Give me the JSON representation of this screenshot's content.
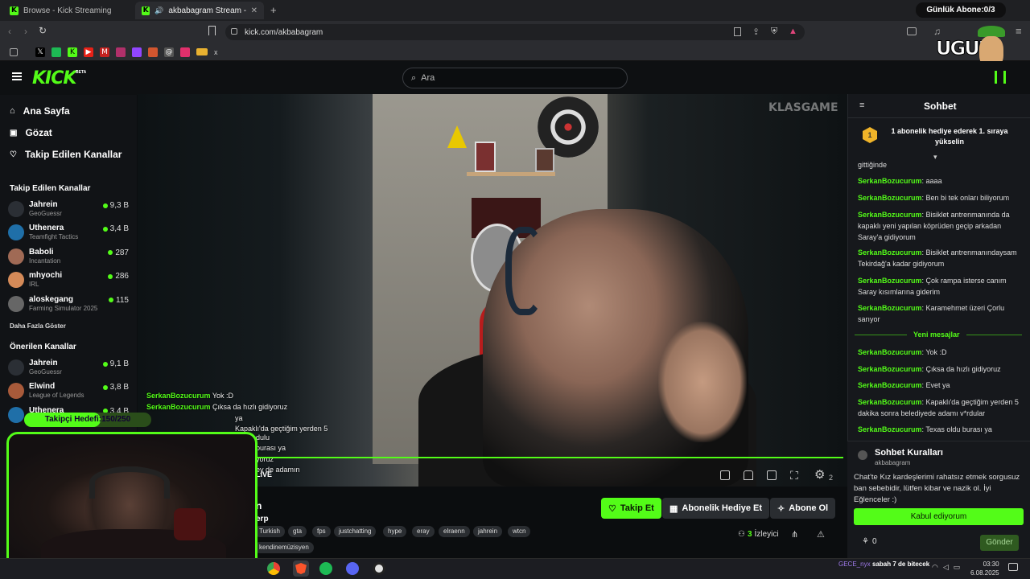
{
  "browser": {
    "tabs": [
      {
        "title": "Browse - Kick Streaming"
      },
      {
        "title": "akbabagram Stream - Watch L"
      }
    ],
    "url": "kick.com/akbabagram",
    "sub_counter": "Günlük Abone:0/3",
    "overlay_logo_text": "UGUR"
  },
  "header": {
    "logo": "KICK",
    "logo_badge": "BETA",
    "search_placeholder": "Ara"
  },
  "sidebar": {
    "nav": [
      {
        "label": "Ana Sayfa",
        "icon": "home-icon"
      },
      {
        "label": "Gözat",
        "icon": "browse-icon"
      },
      {
        "label": "Takip Edilen Kanallar",
        "icon": "heart-icon"
      }
    ],
    "followed_title": "Takip Edilen Kanallar",
    "followed": [
      {
        "name": "Jahrein",
        "game": "GeoGuessr",
        "viewers": "9,3 B",
        "color": "#2b2f35"
      },
      {
        "name": "Uthenera",
        "game": "Teamfight Tactics",
        "viewers": "3,4 B",
        "color": "#1f6fa8"
      },
      {
        "name": "Baboli",
        "game": "Incantation",
        "viewers": "287",
        "color": "#a06a55"
      },
      {
        "name": "mhyochi",
        "game": "IRL",
        "viewers": "286",
        "color": "#d48a58"
      },
      {
        "name": "aloskegang",
        "game": "Farming Simulator 2025",
        "viewers": "115",
        "color": "#666"
      }
    ],
    "show_more": "Daha Fazla Göster",
    "recommended_title": "Önerilen Kanallar",
    "recommended": [
      {
        "name": "Jahrein",
        "game": "GeoGuessr",
        "viewers": "9,1 B",
        "color": "#2b2f35"
      },
      {
        "name": "Elwind",
        "game": "League of Legends",
        "viewers": "3,8 B",
        "color": "#a85a3a"
      },
      {
        "name": "Uthenera",
        "game": "",
        "viewers": "3,4 B",
        "color": "#1f6fa8"
      }
    ]
  },
  "stream": {
    "overlay_watermark": "KLASGAME",
    "overlay_chat": [
      {
        "user": "SerkanBozucurum",
        "text": "Yok :D"
      },
      {
        "user": "SerkanBozucurum",
        "text": "Çıksa da hızlı gidiyoruz"
      },
      {
        "user": "",
        "text": "ya"
      },
      {
        "user": "",
        "text": "Kapaklı'da geçtiğim yerden 5"
      },
      {
        "user": "",
        "text": "dulu"
      },
      {
        "user": "",
        "text": "burası ya"
      },
      {
        "user": "",
        "text": "yoruz"
      },
      {
        "user": "",
        "text": "ey de adamın"
      }
    ],
    "goal_label": "Takipçi Hedefi:150/250",
    "goal_fraction": 0.6,
    "live_label": "LIVE",
    "player_count": "2",
    "title_partial": "n",
    "category_partial": "erp",
    "tags": [
      "Turkish",
      "gta",
      "fps",
      "justchatting",
      "hype",
      "eray",
      "elraenn",
      "jahrein",
      "wtcn",
      "kendinemüzisyen"
    ],
    "buttons": {
      "follow": "Takip Et",
      "gift": "Abonelik Hediye Et",
      "subscribe": "Abone Ol"
    },
    "viewer_count": "3",
    "viewer_label": "İzleyici"
  },
  "chat": {
    "title": "Sohbet",
    "pinned": "1 abonelik hediye ederek 1. sıraya yükselin",
    "pinned_rank": "1",
    "messages_before": [
      {
        "user": "",
        "text": "gittiğinde"
      },
      {
        "user": "SerkanBozucurum",
        "text": "aaaa"
      },
      {
        "user": "SerkanBozucurum",
        "text": "Ben bi tek onları biliyorum"
      },
      {
        "user": "SerkanBozucurum",
        "text": "Bisiklet antrenmanında da kapaklı yeni yapılan köprüden geçip arkadan Saray'a gidiyorum"
      },
      {
        "user": "SerkanBozucurum",
        "text": "Bisiklet antrenmanındaysam Tekirdağ'a kadar gidiyorum"
      },
      {
        "user": "SerkanBozucurum",
        "text": "Çok rampa isterse canım Saray kısımlarına giderim"
      },
      {
        "user": "SerkanBozucurum",
        "text": "Karamehmet üzeri Çorlu sarıyor"
      }
    ],
    "new_messages_label": "Yeni mesajlar",
    "messages_after": [
      {
        "user": "SerkanBozucurum",
        "text": "Yok :D"
      },
      {
        "user": "SerkanBozucurum",
        "text": "Çıksa da hızlı gidiyoruz"
      },
      {
        "user": "SerkanBozucurum",
        "text": "Evet ya"
      },
      {
        "user": "SerkanBozucurum",
        "text": "Kapaklı'da geçtiğim yerden 5 dakika sonra belediyede adamı v*rdular"
      },
      {
        "user": "SerkanBozucurum",
        "text": "Texas oldu burası ya"
      }
    ],
    "rules_title": "Sohbet Kuralları",
    "rules_owner": "akbabagram",
    "rules_text": "Chat'te Kız kardeşlerimi rahatsız etmek sorgusuz ban sebebidir, lütfen kibar ve nazik ol. İyi Eğlenceler :)",
    "accept_label": "Kabul ediyorum",
    "points": "0",
    "send_label": "Gönder"
  },
  "taskbar": {
    "now_playing": "GECE_nyx",
    "song": "sabah 7 de bitecek",
    "time": "03:30",
    "date": "6.08.2025"
  },
  "colors": {
    "brand": "#53fc18",
    "bg": "#0b0d0f",
    "panel": "#16181c"
  }
}
